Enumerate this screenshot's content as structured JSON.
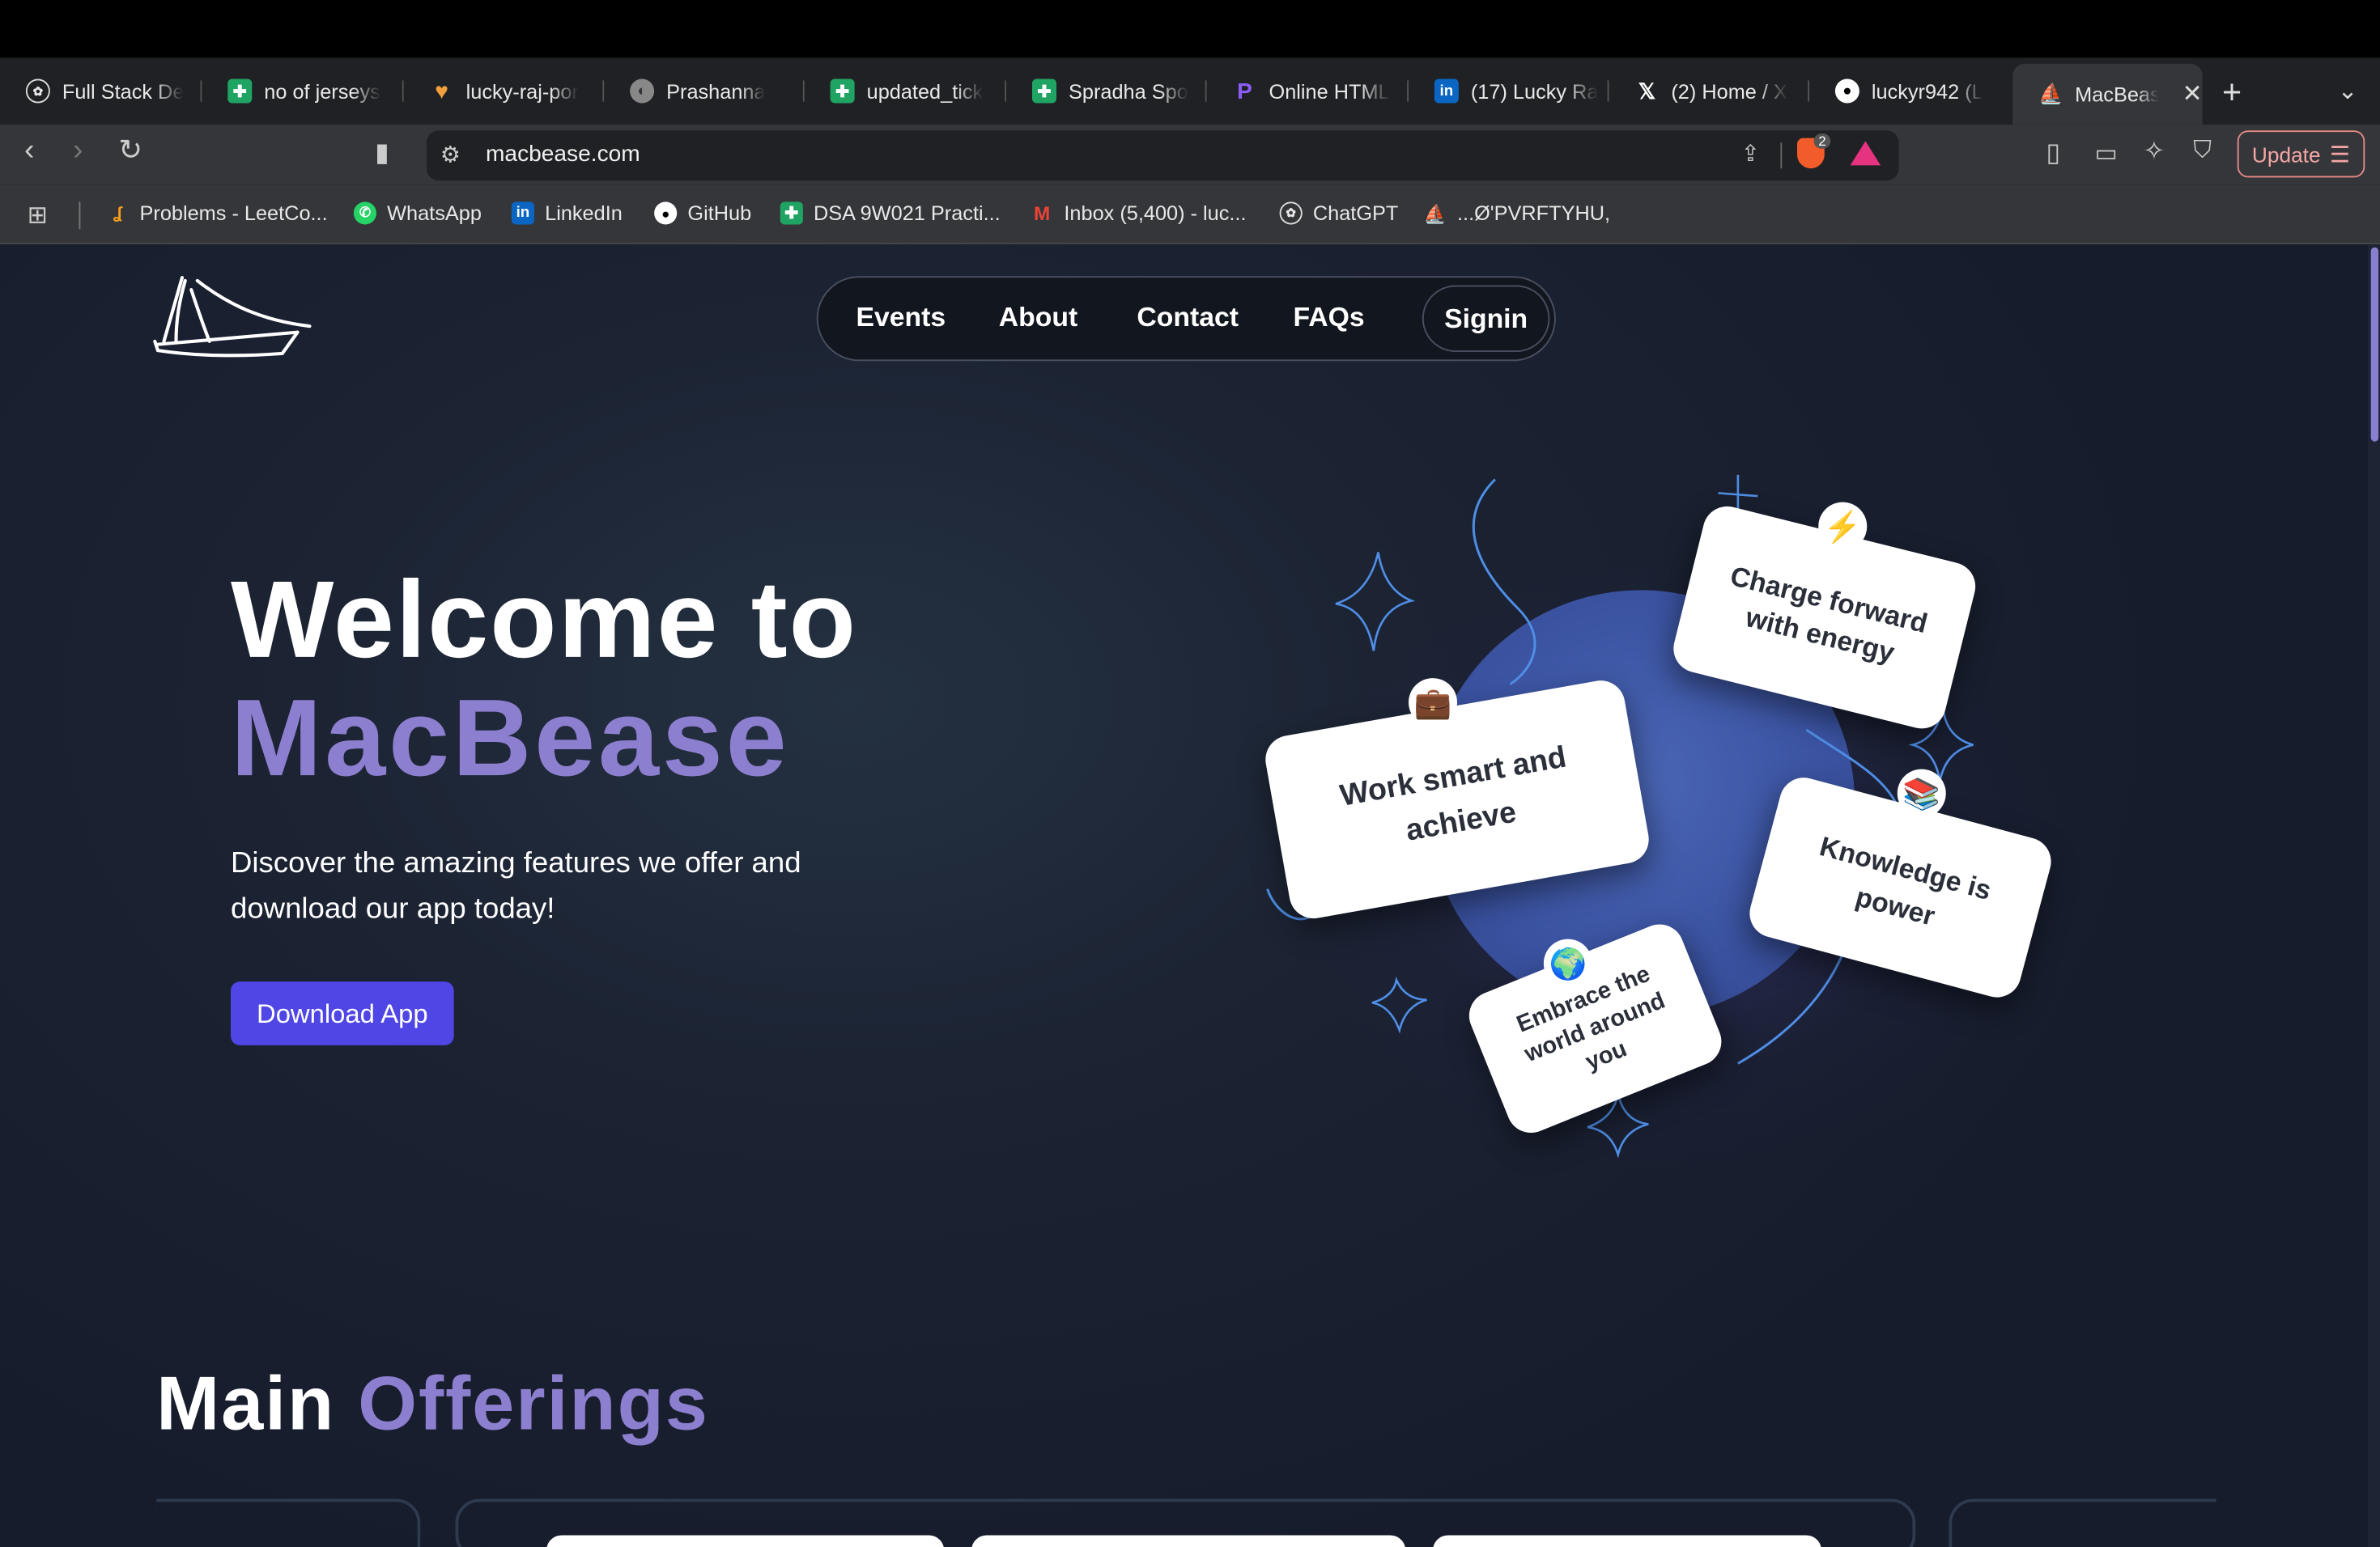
{
  "browser": {
    "tabs": [
      {
        "title": "Full Stack De",
        "icon": "openai-icon"
      },
      {
        "title": "no of jerseys",
        "icon": "google-sheets-icon"
      },
      {
        "title": "lucky-raj-por",
        "icon": "heart-icon"
      },
      {
        "title": "Prashanna",
        "icon": "globe-icon"
      },
      {
        "title": "updated_tick",
        "icon": "google-sheets-icon"
      },
      {
        "title": "Spradha Spo",
        "icon": "google-sheets-icon"
      },
      {
        "title": "Online HTML",
        "icon": "p-logo-icon"
      },
      {
        "title": "(17) Lucky Ra",
        "icon": "linkedin-icon"
      },
      {
        "title": "(2) Home / X",
        "icon": "x-icon"
      },
      {
        "title": "luckyr942 (L",
        "icon": "github-icon"
      },
      {
        "title": "MacBeas",
        "icon": "sailboat-icon",
        "active": true
      }
    ],
    "url": "macbease.com",
    "shield_count": "2",
    "update_label": "Update",
    "bookmarks": [
      {
        "label": "Problems - LeetCo...",
        "icon": "leetcode-icon"
      },
      {
        "label": "WhatsApp",
        "icon": "whatsapp-icon"
      },
      {
        "label": "LinkedIn",
        "icon": "linkedin-icon"
      },
      {
        "label": "GitHub",
        "icon": "github-icon"
      },
      {
        "label": "DSA 9W021 Practi...",
        "icon": "google-sheets-icon"
      },
      {
        "label": "Inbox (5,400) - luc...",
        "icon": "gmail-icon"
      },
      {
        "label": "ChatGPT",
        "icon": "openai-icon"
      },
      {
        "label": "...Ø'PVRFTYHU,",
        "icon": "sailboat-icon"
      }
    ]
  },
  "site": {
    "nav": [
      "Events",
      "About",
      "Contact",
      "FAQs"
    ],
    "signin": "Signin",
    "hero": {
      "title_line1": "Welcome to",
      "title_line2": "MacBease",
      "subtitle": "Discover the amazing features we offer and download our app today!",
      "cta": "Download App"
    },
    "cards": {
      "energy": "Charge forward with energy",
      "work": "Work smart and achieve",
      "knowledge": "Knowledge is power",
      "world": "Embrace the world around you"
    },
    "section": {
      "word1": "Main",
      "word2": "Offerings"
    }
  },
  "colors": {
    "accent_purple": "#8d7fcf",
    "button": "#4f46e5",
    "page_bg": "#1b2232"
  }
}
